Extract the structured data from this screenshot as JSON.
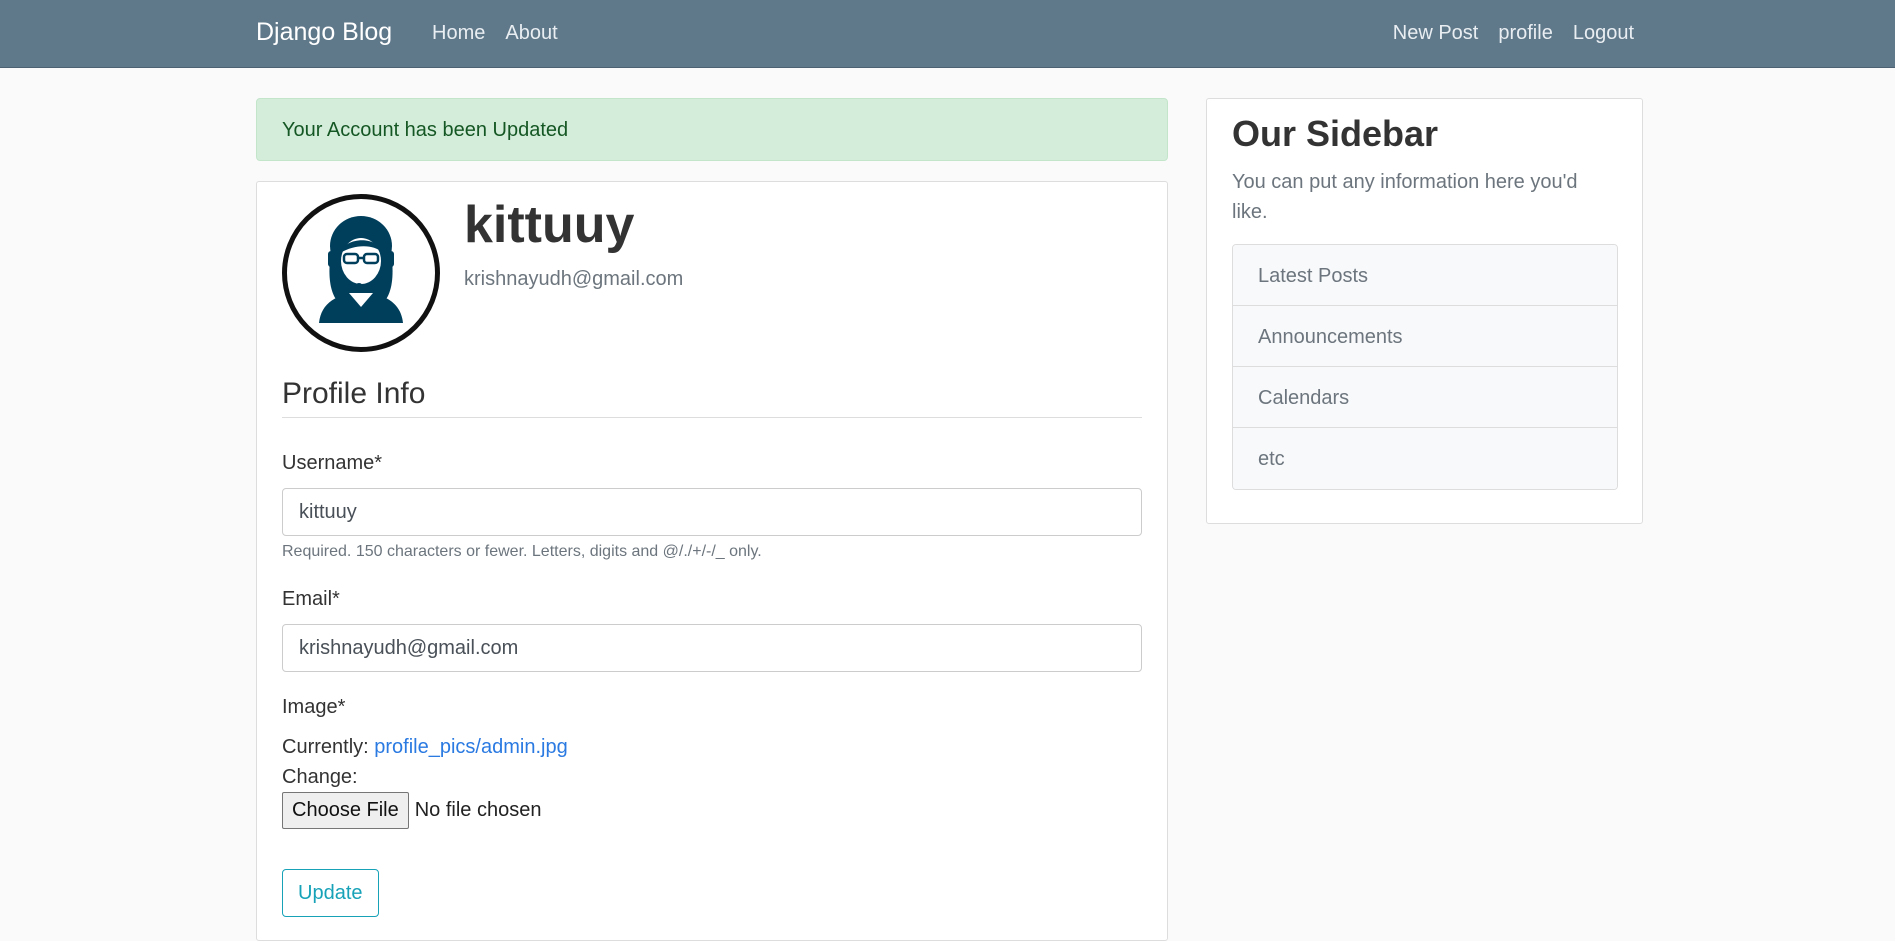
{
  "navbar": {
    "brand": "Django Blog",
    "left_links": [
      "Home",
      "About"
    ],
    "right_links": [
      "New Post",
      "profile",
      "Logout"
    ],
    "background": "#5f788a"
  },
  "alert": {
    "message": "Your Account has been Updated",
    "color": "#d4edda"
  },
  "profile": {
    "username": "kittuuy",
    "email": "krishnayudh@gmail.com",
    "avatar_label": "ADMIN",
    "avatar_color": "#003f5c"
  },
  "form": {
    "legend": "Profile Info",
    "username_label": "Username*",
    "username_value": "kittuuy",
    "username_help": "Required. 150 characters or fewer. Letters, digits and @/./+/-/_ only.",
    "email_label": "Email*",
    "email_value": "krishnayudh@gmail.com",
    "image_label": "Image*",
    "currently_label": "Currently:",
    "current_file": "profile_pics/admin.jpg",
    "change_label": "Change:",
    "choose_file_label": "Choose File",
    "file_status": "No file chosen",
    "submit_label": "Update",
    "accent": "#17a2b8"
  },
  "sidebar": {
    "title": "Our Sidebar",
    "text": "You can put any information here you'd like.",
    "items": [
      "Latest Posts",
      "Announcements",
      "Calendars",
      "etc"
    ]
  }
}
